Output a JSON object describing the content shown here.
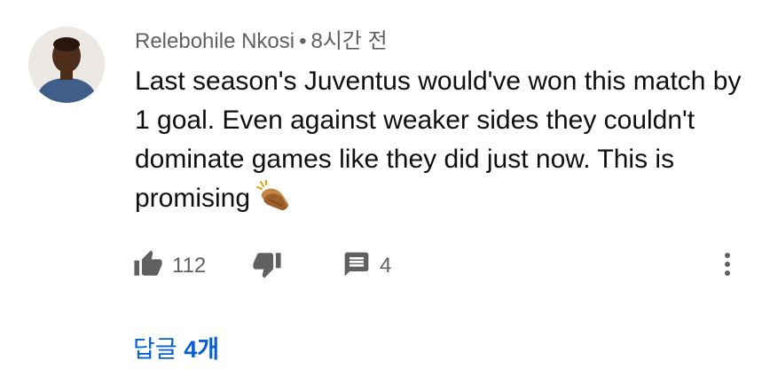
{
  "comment": {
    "author": "Relebohile Nkosi",
    "separator": "•",
    "time": "8시간 전",
    "text": "Last season's Juventus would've won this match by 1 goal. Even against weaker sides they couldn't dominate games like they did just now. This is promising",
    "emoji_icon": "clapping-hands-icon"
  },
  "actions": {
    "like_count": "112",
    "reply_count": "4"
  },
  "replies": {
    "label_prefix": "답글",
    "count_label": "4개"
  },
  "colors": {
    "link": "#065fd4",
    "meta": "#606060",
    "icon": "#606060"
  }
}
